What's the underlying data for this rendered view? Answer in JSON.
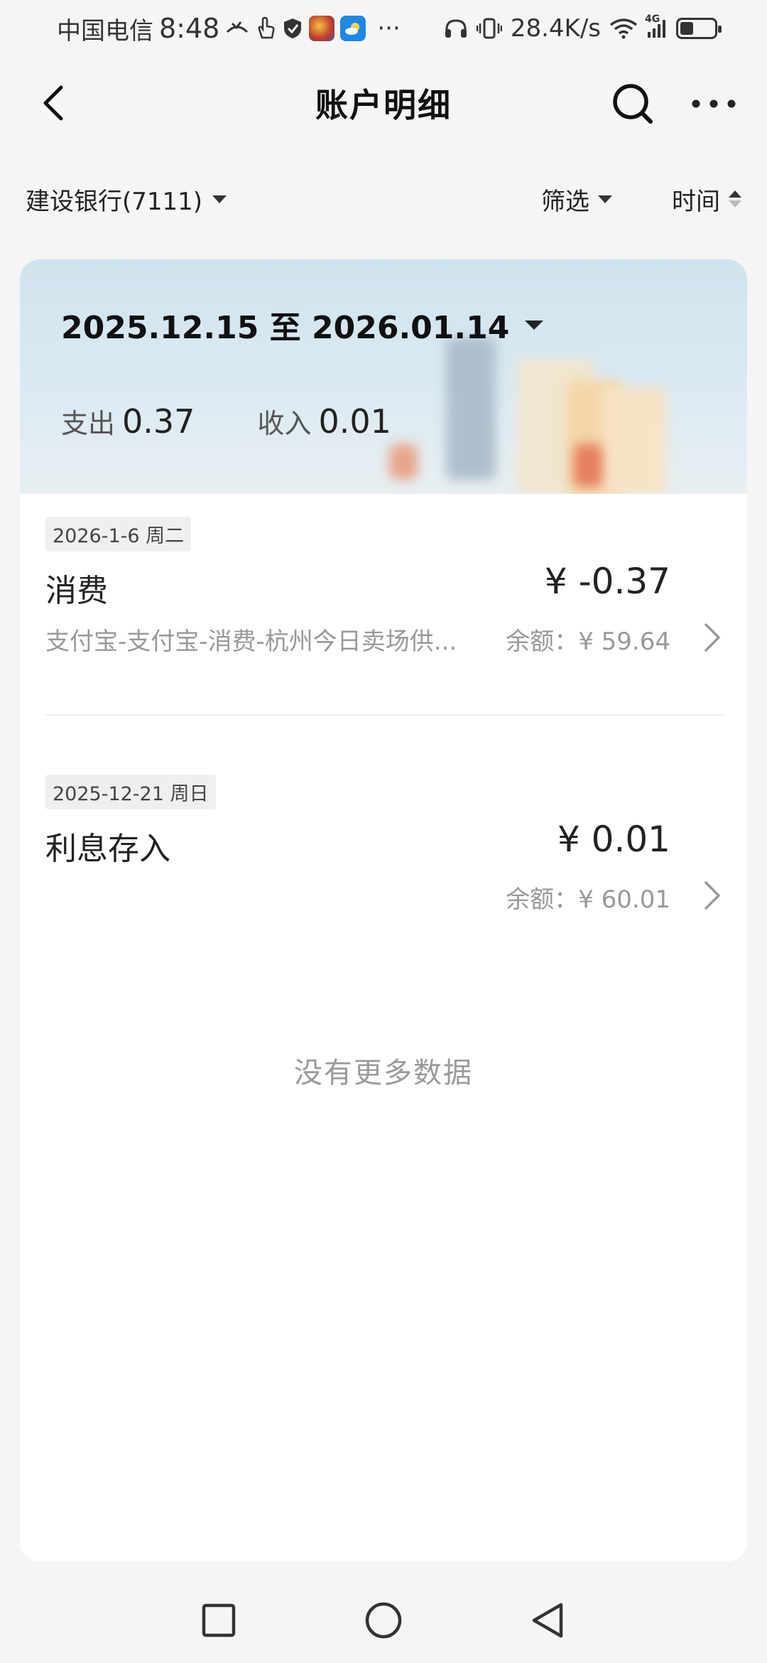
{
  "status_bar": {
    "carrier": "中国电信",
    "time": "8:48",
    "overflow": "···",
    "net_speed": "28.4K/s",
    "network": "4G",
    "battery_level": 0.4
  },
  "nav": {
    "title": "账户明细",
    "back_icon": "chevron-left-icon",
    "search_icon": "search-icon",
    "more_icon": "more-horizontal-icon"
  },
  "filters": {
    "account": "建设银行(7111)",
    "filter_label": "筛选",
    "time_label": "时间"
  },
  "summary": {
    "date_range": "2025.12.15 至 2026.01.14",
    "expense_label": "支出",
    "expense_value": "0.37",
    "income_label": "收入",
    "income_value": "0.01"
  },
  "transactions": [
    {
      "date": "2026-1-6 周二",
      "title": "消费",
      "amount": "¥ -0.37",
      "description": "支付宝-支付宝-消费-杭州今日卖场供...",
      "balance": "余额：¥ 59.64"
    },
    {
      "date": "2025-12-21 周日",
      "title": "利息存入",
      "amount": "¥ 0.01",
      "description": "",
      "balance": "余额：¥ 60.01"
    }
  ],
  "footer_text": "没有更多数据",
  "colors": {
    "background": "#f5f5f5",
    "card": "#ffffff",
    "muted_text": "#999999"
  }
}
